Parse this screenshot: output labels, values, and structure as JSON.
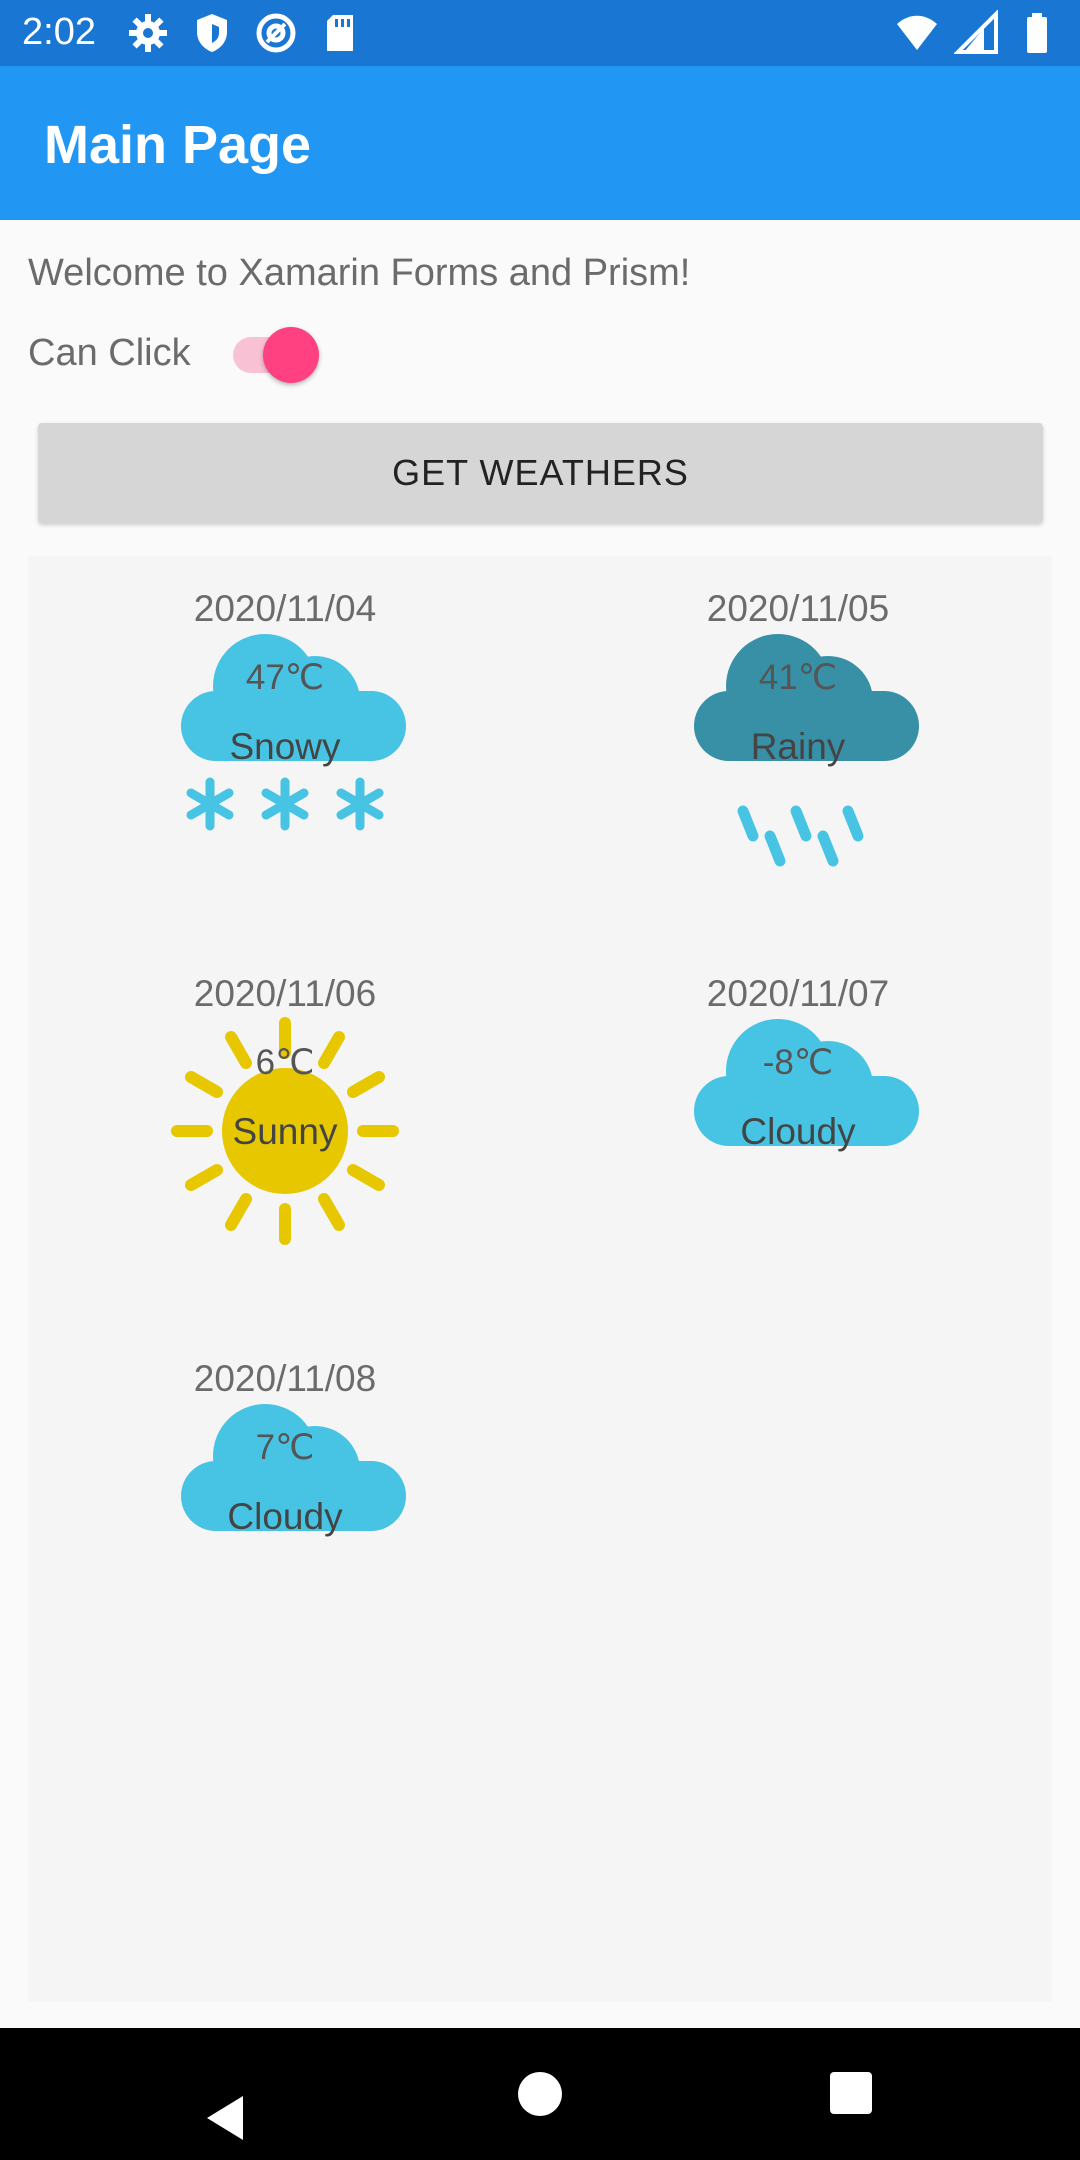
{
  "status_bar": {
    "time": "2:02",
    "left_icons": [
      "gear-icon",
      "shield-icon",
      "at-icon",
      "sd-card-icon"
    ],
    "right_icons": [
      "wifi-icon",
      "signal-icon",
      "battery-icon"
    ]
  },
  "app_bar": {
    "title": "Main Page"
  },
  "main": {
    "welcome_text": "Welcome to Xamarin Forms and Prism!",
    "can_click_label": "Can Click",
    "can_click_on": true,
    "get_weathers_label": "GET WEATHERS"
  },
  "weathers": [
    {
      "date": "2020/11/04",
      "temp": "47℃",
      "condition": "Snowy",
      "icon": "snow-cloud-icon"
    },
    {
      "date": "2020/11/05",
      "temp": "41℃",
      "condition": "Rainy",
      "icon": "rain-cloud-icon"
    },
    {
      "date": "2020/11/06",
      "temp": "6℃",
      "condition": "Sunny",
      "icon": "sun-icon"
    },
    {
      "date": "2020/11/07",
      "temp": "-8℃",
      "condition": "Cloudy",
      "icon": "cloud-icon"
    },
    {
      "date": "2020/11/08",
      "temp": "7℃",
      "condition": "Cloudy",
      "icon": "cloud-icon"
    }
  ],
  "colors": {
    "status_bar": "#1976d2",
    "app_bar": "#2196f3",
    "toggle_thumb": "#ff4081",
    "cloud": "#47c3e4",
    "rain_cloud": "#3890a6",
    "sun": "#e6c700"
  },
  "nav_bar": {
    "icons": [
      "back-icon",
      "home-icon",
      "recents-icon"
    ]
  }
}
